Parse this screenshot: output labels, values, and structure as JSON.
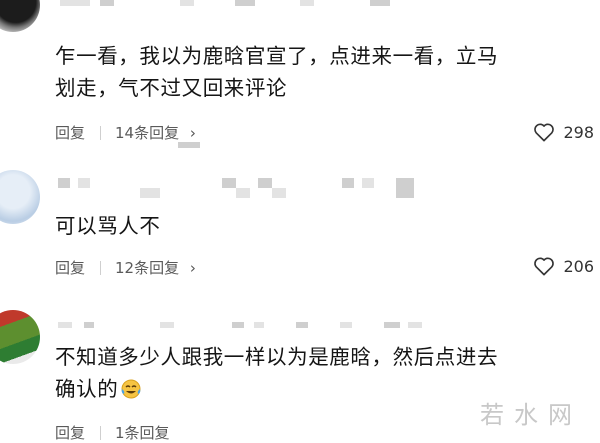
{
  "comments": [
    {
      "text_line1": "乍一看，我以为鹿晗官宣了，点进来一看，立马",
      "text_line2": "划走，气不过又回来评论",
      "reply_label": "回复",
      "replies_label": "14条回复",
      "likes": "298"
    },
    {
      "text_line1": "可以骂人不",
      "reply_label": "回复",
      "replies_label": "12条回复",
      "likes": "206"
    },
    {
      "text_line1": "不知道多少人跟我一样以为是鹿晗，然后点进去",
      "text_line2": "确认的",
      "reply_label": "回复",
      "replies_label": "1条回复"
    }
  ],
  "watermark": "若水网",
  "icons": {
    "like": "heart-outline-icon",
    "chevron": "chevron-right-icon",
    "emoji": "crying-laughing-emoji-icon"
  }
}
